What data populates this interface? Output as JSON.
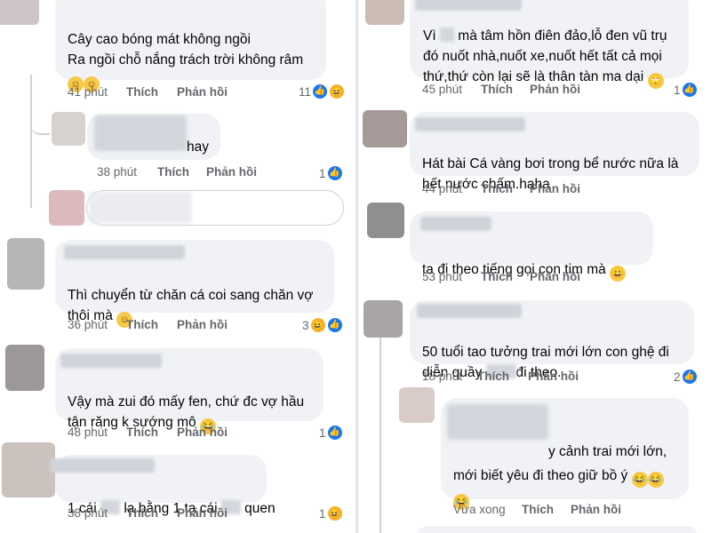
{
  "colors": {
    "bubble": "#f0f2f5",
    "meta": "#65676b",
    "like": "#1877f2",
    "haha": "#f7b125"
  },
  "left": {
    "c1": {
      "line1": "Cây cao bóng mát không ngồi",
      "line2": "Ra ngồi chỗ nắng trách trời không râm",
      "time": "41 phút",
      "like": "Thích",
      "reply": "Phản hồi",
      "count": "11"
    },
    "c2": {
      "text": "hay",
      "time": "38 phút",
      "like": "Thích",
      "reply": "Phản hồi",
      "count": "1"
    },
    "c3": {
      "line1": "Thì chuyển từ chăn cá coi sang chăn vợ",
      "line2": "thôi mà",
      "time": "36 phút",
      "like": "Thích",
      "reply": "Phản hồi",
      "count": "3"
    },
    "c4": {
      "line1": "Vậy mà zui đó mấy fen, chứ đc vợ hầu",
      "line2": "tận răng k sướng mô",
      "time": "48 phút",
      "like": "Thích",
      "reply": "Phản hồi",
      "count": "1"
    },
    "c5": {
      "part1": "1 cái",
      "part2": "lạ bằng 1 tạ cái",
      "part3": "quen",
      "time": "38 phút",
      "like": "Thích",
      "reply": "Phản hồi",
      "count": "1"
    }
  },
  "right": {
    "c1": {
      "line1a": "Vì",
      "line1b": "mà tâm hồn điên đảo,lỗ đen vũ trụ",
      "line2": "đó nuốt nhà,nuốt xe,nuốt hết tất cả mọi",
      "line3": "thứ,thứ còn lại sẽ là thân tàn ma dại",
      "time": "45 phút",
      "like": "Thích",
      "reply": "Phản hồi",
      "count": "1"
    },
    "c2": {
      "line1": "Hát bài Cá vàng bơi trong bể nước nữa là",
      "line2": "hết nước chấm.haha",
      "time": "44 phút",
      "like": "Thích",
      "reply": "Phản hồi"
    },
    "c3": {
      "text": "ta đi theo tiếng gọi con tim mà",
      "time": "53 phút",
      "like": "Thích",
      "reply": "Phản hồi"
    },
    "c4": {
      "line1": "50 tuổi tao tưởng trai mới lớn con ghệ đi",
      "line2a": "diễn quầy",
      "line2b": "đi theo.",
      "time": "18 phút",
      "like": "Thích",
      "reply": "Phản hồi",
      "count": "2"
    },
    "c5": {
      "line1": "y cảnh trai mới lớn,",
      "line2": "mới biết yêu đi theo giữ bồ ý",
      "time": "Vừa xong",
      "like": "Thích",
      "reply": "Phản hồi"
    }
  }
}
